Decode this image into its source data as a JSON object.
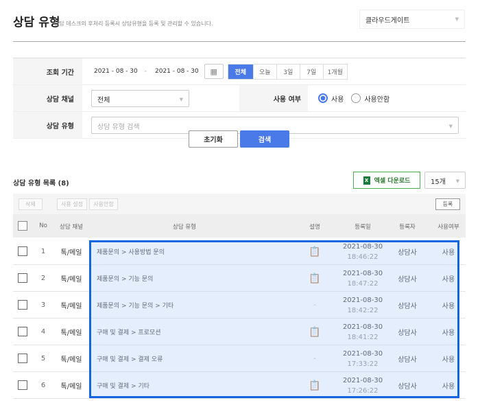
{
  "header": {
    "title": "상담 유형",
    "subtitle": "상담 데스크의 후처리 등록시 상담유형을 등록 및 관리할 수 있습니다.",
    "company": "클라우드게이트"
  },
  "filters": {
    "period_label": "조회 기간",
    "date_from": "2021 - 08 - 30",
    "date_sep": "-",
    "date_to": "2021 - 08 - 30",
    "ranges": [
      "전체",
      "오늘",
      "3일",
      "7일",
      "1개월"
    ],
    "channel_label": "상담 채널",
    "channel_value": "전체",
    "usage_label": "사용 여부",
    "usage_options": [
      "사용",
      "사용안함"
    ],
    "type_label": "상담 유형",
    "type_placeholder": "상담 유형 검색",
    "reset": "초기화",
    "search": "검색"
  },
  "list": {
    "title": "상담 유형 목록 (8)",
    "excel": "엑셀 다운로드",
    "excel_icon": "X",
    "page_size": "15개",
    "toolbar": {
      "delete": "삭제",
      "use_set": "사용 설정",
      "unuse": "사용안함",
      "register": "등록"
    },
    "columns": [
      "No",
      "상담 채널",
      "상담 유형",
      "설명",
      "등록일",
      "등록자",
      "사용여부"
    ],
    "rows": [
      {
        "no": "1",
        "channel": "톡/메일",
        "type": "제품문의 > 사용방법 문의",
        "desc": "icon",
        "date": "2021-08-30",
        "time": "18:46:22",
        "by": "상담사",
        "use": "사용"
      },
      {
        "no": "2",
        "channel": "톡/메일",
        "type": "제품문의 > 기능 문의",
        "desc": "icon",
        "date": "2021-08-30",
        "time": "18:47:22",
        "by": "상담사",
        "use": "사용"
      },
      {
        "no": "3",
        "channel": "톡/메일",
        "type": "제품문의 > 기능 문의 > 기타",
        "desc": "-",
        "date": "2021-08-30",
        "time": "18:42:22",
        "by": "상담사",
        "use": "사용"
      },
      {
        "no": "4",
        "channel": "톡/메일",
        "type": "구매 및 결제 > 프로모션",
        "desc": "icon",
        "date": "2021-08-30",
        "time": "18:41:22",
        "by": "상담사",
        "use": "사용"
      },
      {
        "no": "5",
        "channel": "톡/메일",
        "type": "구매 및 결제 > 결제 오류",
        "desc": "-",
        "date": "2021-08-30",
        "time": "17:33:22",
        "by": "상담사",
        "use": "사용"
      },
      {
        "no": "6",
        "channel": "톡/메일",
        "type": "구매 및 결제 > 기타",
        "desc": "icon",
        "date": "2021-08-30",
        "time": "17:26:22",
        "by": "상담사",
        "use": "사용"
      }
    ]
  },
  "colors": {
    "accent": "#4a79e8",
    "highlight": "#1565e0",
    "excel": "#2e7d32"
  }
}
